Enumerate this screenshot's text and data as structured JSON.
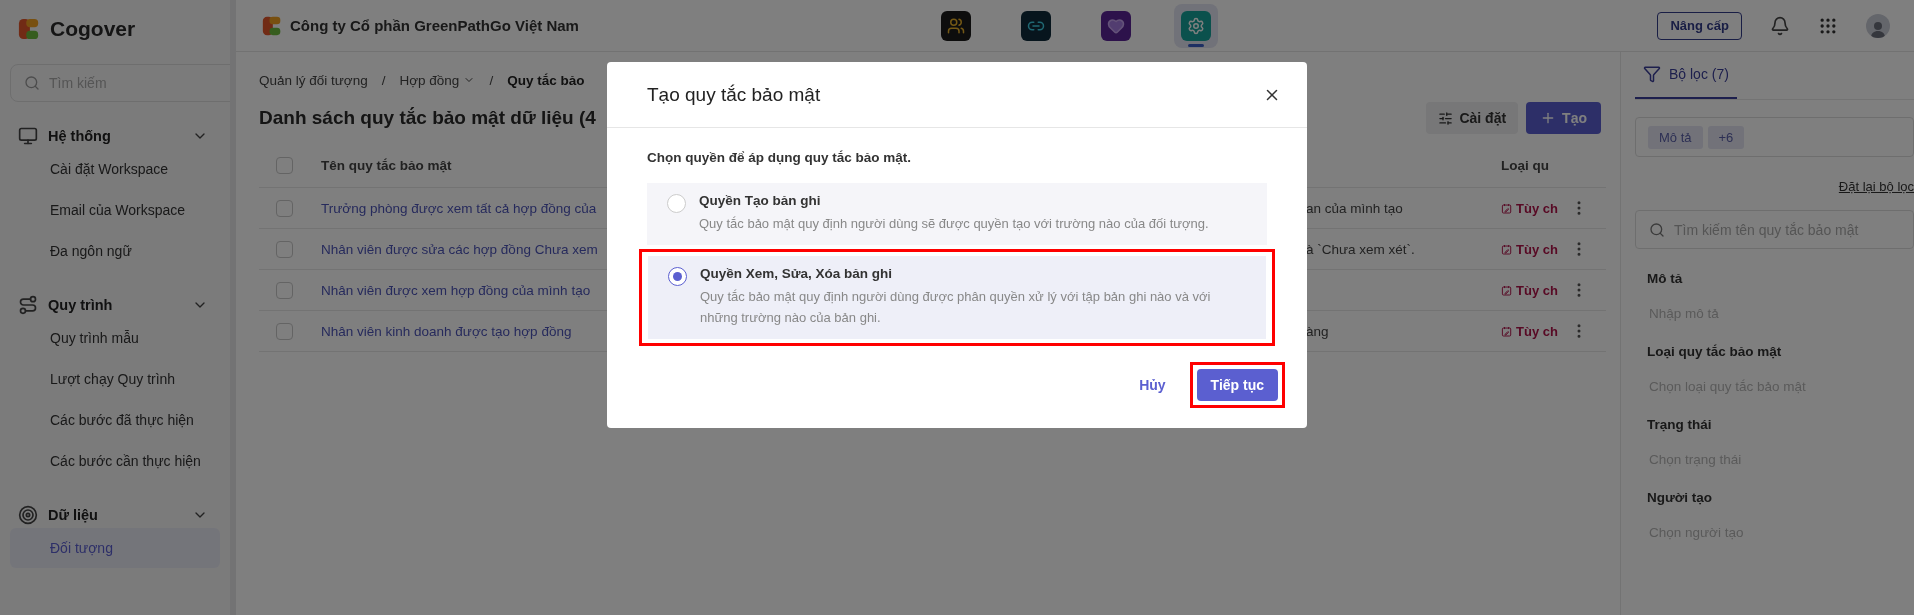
{
  "sidebar": {
    "brand": "Cogover",
    "search_placeholder": "Tìm kiếm",
    "groups": [
      {
        "label": "Hệ thống",
        "kind": "system",
        "expanded": true,
        "items": [
          {
            "label": "Cài đặt Workspace",
            "selected": false
          },
          {
            "label": "Email của Workspace",
            "selected": false
          },
          {
            "label": "Đa ngôn ngữ",
            "selected": false
          }
        ]
      },
      {
        "label": "Quy trình",
        "kind": "workflow",
        "expanded": true,
        "items": [
          {
            "label": "Quy trình mẫu",
            "selected": false
          },
          {
            "label": "Lượt chạy Quy trình",
            "selected": false
          },
          {
            "label": "Các bước đã thực hiện",
            "selected": false
          },
          {
            "label": "Các bước cần thực hiện",
            "selected": false
          }
        ]
      },
      {
        "label": "Dữ liệu",
        "kind": "data",
        "expanded": true,
        "items": [
          {
            "label": "Đối tượng",
            "selected": true
          }
        ]
      }
    ]
  },
  "header": {
    "company": "Công ty Cổ phần GreenPathGo Việt Nam",
    "apps": [
      {
        "kind": "people",
        "selected": false
      },
      {
        "kind": "link",
        "selected": false
      },
      {
        "kind": "heart",
        "selected": false
      },
      {
        "kind": "settings",
        "selected": true
      }
    ],
    "upgrade": "Nâng cấp"
  },
  "breadcrumbs": [
    {
      "kind": "link",
      "label": "Quản lý đối tượng"
    },
    {
      "kind": "separator",
      "label": "/"
    },
    {
      "kind": "dropdown",
      "label": "Hợp đồng"
    },
    {
      "kind": "separator",
      "label": "/"
    },
    {
      "kind": "current",
      "label": "Quy tắc bảo"
    }
  ],
  "page_title": "Danh sách quy tắc bảo mật dữ liệu (4",
  "toolbar": {
    "settings": "Cài đặt",
    "create": "Tạo"
  },
  "table": {
    "header_checked": false,
    "name_header": "Tên quy tắc bảo mật",
    "type_header": "Loại qu",
    "rows": [
      {
        "checked": false,
        "name": "Trưởng phòng được xem tất cả hợp đồng của",
        "description": "an của mình tạo",
        "type": "Tùy ch"
      },
      {
        "checked": false,
        "name": "Nhân viên được sửa các hợp đồng Chưa xem",
        "description": "à `Chưa xem xét`.",
        "type": "Tùy ch"
      },
      {
        "checked": false,
        "name": "Nhân viên được xem hợp đồng của mình tạo",
        "type": "Tùy ch"
      },
      {
        "checked": false,
        "name": "Nhân viên kinh doanh được tạo hợp đồng",
        "description": "àng",
        "type": "Tùy ch"
      }
    ]
  },
  "modal": {
    "title": "Tạo quy tắc bảo mật",
    "prompt": "Chọn quyền để áp dụng quy tắc bảo mật.",
    "options": [
      {
        "title": "Quyền Tạo bản ghi",
        "description": "Quy tắc bảo mật quy định người dùng sẽ được quyền tạo với trường nào của đối tượng.",
        "selected": false,
        "highlighted": false
      },
      {
        "title": "Quyền Xem, Sửa, Xóa bản ghi",
        "description": "Quy tắc bảo mật quy định người dùng được phân quyền xử lý với tập bản ghi nào và với những trường nào của bản ghi.",
        "selected": true,
        "highlighted": true
      }
    ],
    "cancel": "Hủy",
    "confirm": {
      "label": "Tiếp tục",
      "highlighted": true
    }
  },
  "filter_panel": {
    "tab": "Bộ lọc (7)",
    "tab_selected": true,
    "chips": [
      "Mô tả",
      "+6"
    ],
    "reset": "Đặt lại bộ lọc",
    "search_placeholder": "Tìm kiếm tên quy tắc bảo mật",
    "fields": [
      {
        "label": "Mô tả",
        "placeholder": "Nhập mô tả"
      },
      {
        "label": "Loại quy tắc bảo mật",
        "placeholder": "Chọn loại quy tắc bảo mật"
      },
      {
        "label": "Trạng thái",
        "placeholder": "Chọn trạng thái"
      },
      {
        "label": "Người tạo",
        "placeholder": "Chọn người tạo"
      }
    ]
  }
}
